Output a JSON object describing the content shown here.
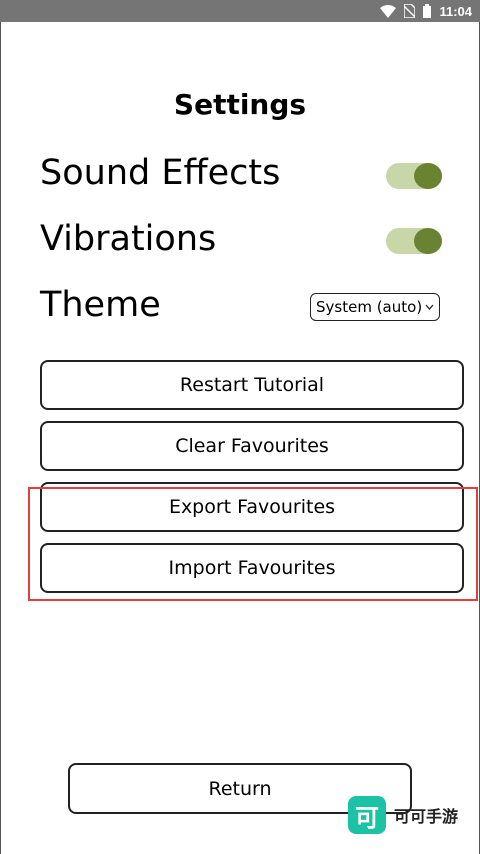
{
  "status_bar": {
    "time": "11:04",
    "icons": [
      "wifi-icon",
      "no-sim-icon",
      "battery-icon"
    ]
  },
  "page": {
    "title": "Settings"
  },
  "settings": {
    "sound_effects": {
      "label": "Sound Effects",
      "enabled": true
    },
    "vibrations": {
      "label": "Vibrations",
      "enabled": true
    },
    "theme": {
      "label": "Theme",
      "selected": "System (auto)"
    }
  },
  "buttons": {
    "restart_tutorial": "Restart Tutorial",
    "clear_favourites": "Clear Favourites",
    "export_favourites": "Export Favourites",
    "import_favourites": "Import Favourites",
    "return": "Return"
  },
  "watermark": {
    "logo_char": "可",
    "text": "可可手游"
  },
  "colors": {
    "toggle_track": "#c9d6a8",
    "toggle_knob": "#6a8333",
    "highlight_border": "#e04040",
    "watermark_logo": "#1bc3a4"
  }
}
